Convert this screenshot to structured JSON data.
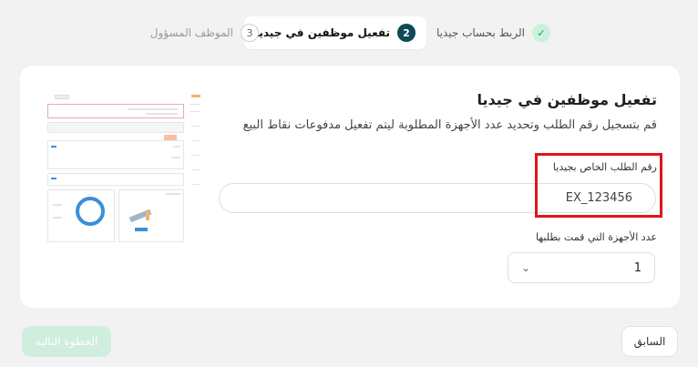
{
  "stepper": {
    "steps": [
      {
        "label": "الربط بحساب جيديا",
        "status": "done",
        "marker": "✓"
      },
      {
        "label": "تفعيل موظفين في جيديا",
        "status": "active",
        "marker": "2"
      },
      {
        "label": "الموظف المسؤول",
        "status": "pending",
        "marker": "3"
      }
    ]
  },
  "card": {
    "title": "تفعيل موظفين في جيديا",
    "description": "قم بتسجيل رقم الطلب وتحديد عدد الأجهزة المطلوبة ليتم تفعيل مدفوعات نقاط البيع",
    "order_field": {
      "label": "رقم الطلب الخاص بجيديا",
      "value": "EX_123456"
    },
    "devices_field": {
      "label": "عدد الأجهزة التي قمت بطلبها",
      "value": "1"
    }
  },
  "footer": {
    "prev_label": "السابق",
    "next_label": "الخطوة التالية"
  },
  "colors": {
    "accent": "#0c4a55",
    "done": "#1a9b59",
    "highlight": "#e0151b",
    "next_disabled": "#cfeedd",
    "preview_ring": "#3b8fd8"
  },
  "icons": {
    "done": "check-icon",
    "select": "chevron-down-icon"
  }
}
